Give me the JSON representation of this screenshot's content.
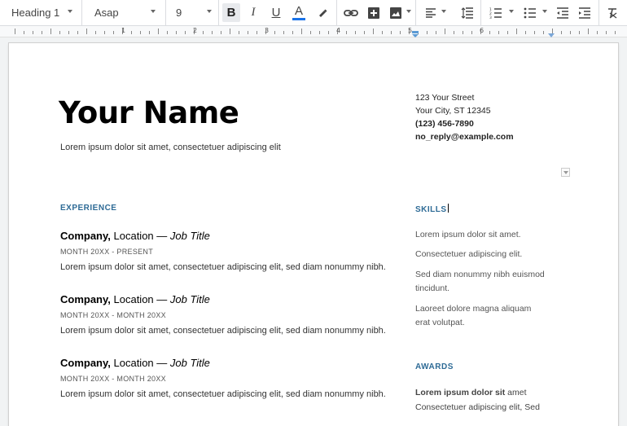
{
  "toolbar": {
    "style": "Heading 1",
    "font": "Asap",
    "font_size": "9",
    "bold": "B",
    "italic": "I",
    "underline": "U",
    "text_color": "A",
    "text_color_swatch": "#1a73e8"
  },
  "ruler": {
    "numbers": [
      "1",
      "2",
      "3",
      "4",
      "5",
      "6"
    ]
  },
  "resume": {
    "name": "Your Name",
    "tagline": "Lorem ipsum dolor sit amet, consectetuer adipiscing elit",
    "contact": {
      "street": "123 Your Street",
      "city": "Your City, ST 12345",
      "phone": "(123) 456-7890",
      "email": "no_reply@example.com"
    },
    "experience_heading": "EXPERIENCE",
    "jobs": [
      {
        "company": "Company,",
        "location": " Location — ",
        "title": "Job Title",
        "dates": "MONTH 20XX - PRESENT",
        "desc": "Lorem ipsum dolor sit amet, consectetuer adipiscing elit, sed diam nonummy nibh."
      },
      {
        "company": "Company,",
        "location": " Location — ",
        "title": "Job Title",
        "dates": "MONTH 20XX - MONTH 20XX",
        "desc": "Lorem ipsum dolor sit amet, consectetuer adipiscing elit, sed diam nonummy nibh."
      },
      {
        "company": "Company,",
        "location": " Location — ",
        "title": "Job Title",
        "dates": "MONTH 20XX - MONTH 20XX",
        "desc": "Lorem ipsum dolor sit amet, consectetuer adipiscing elit, sed diam nonummy nibh."
      }
    ],
    "skills_heading": "SKILLS",
    "skills": [
      "Lorem ipsum dolor sit amet.",
      "Consectetuer adipiscing elit.",
      "Sed diam nonummy nibh euismod",
      "tincidunt.",
      "Laoreet dolore magna aliquam",
      "erat volutpat."
    ],
    "awards_heading": "AWARDS",
    "awards_bold": "Lorem ipsum dolor sit",
    "awards_rest": " amet",
    "awards_line2": "Consectetuer adipiscing elit, Sed"
  }
}
